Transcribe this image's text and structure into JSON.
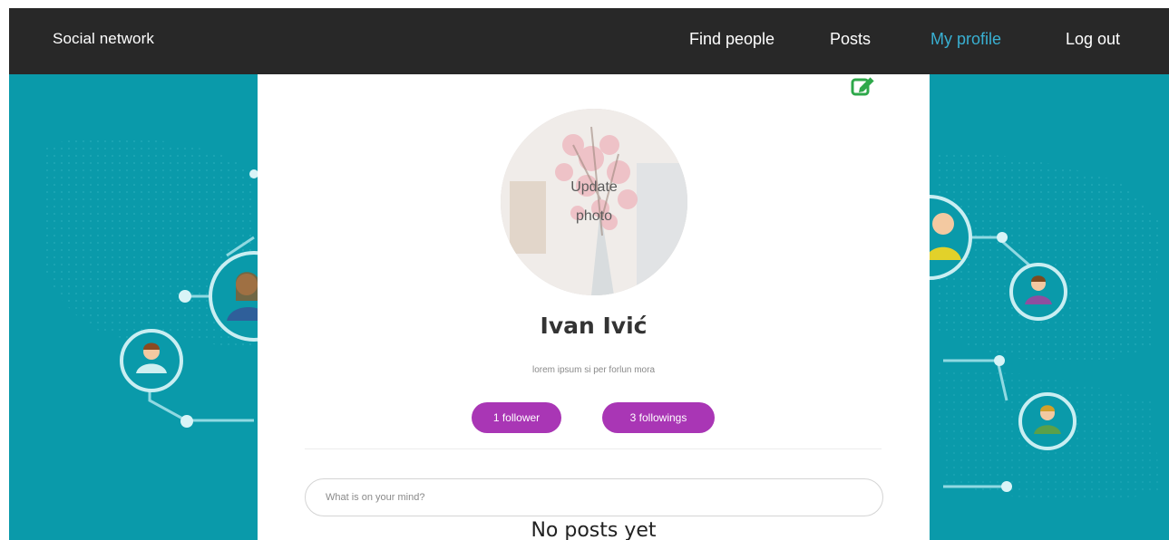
{
  "navbar": {
    "brand": "Social network",
    "links": [
      {
        "label": "Find people",
        "active": false
      },
      {
        "label": "Posts",
        "active": false
      },
      {
        "label": "My profile",
        "active": true
      },
      {
        "label": "Log out",
        "active": false
      }
    ]
  },
  "profile": {
    "name": "Ivan Ivić",
    "bio": "lorem ipsum si per forlun mora",
    "avatar_overlay": "Update photo",
    "followers_label": "1 follower",
    "followings_label": "3 followings",
    "edit_icon": "edit-icon"
  },
  "composer": {
    "placeholder": "What is on your mind?",
    "value": ""
  },
  "posts": {
    "empty_message": "No posts yet"
  },
  "colors": {
    "navbar_bg": "#282828",
    "active_link": "#39b0d2",
    "background_teal": "#0a9aaa",
    "pill_purple": "#a936b5",
    "edit_icon_green": "#2ea84a"
  }
}
